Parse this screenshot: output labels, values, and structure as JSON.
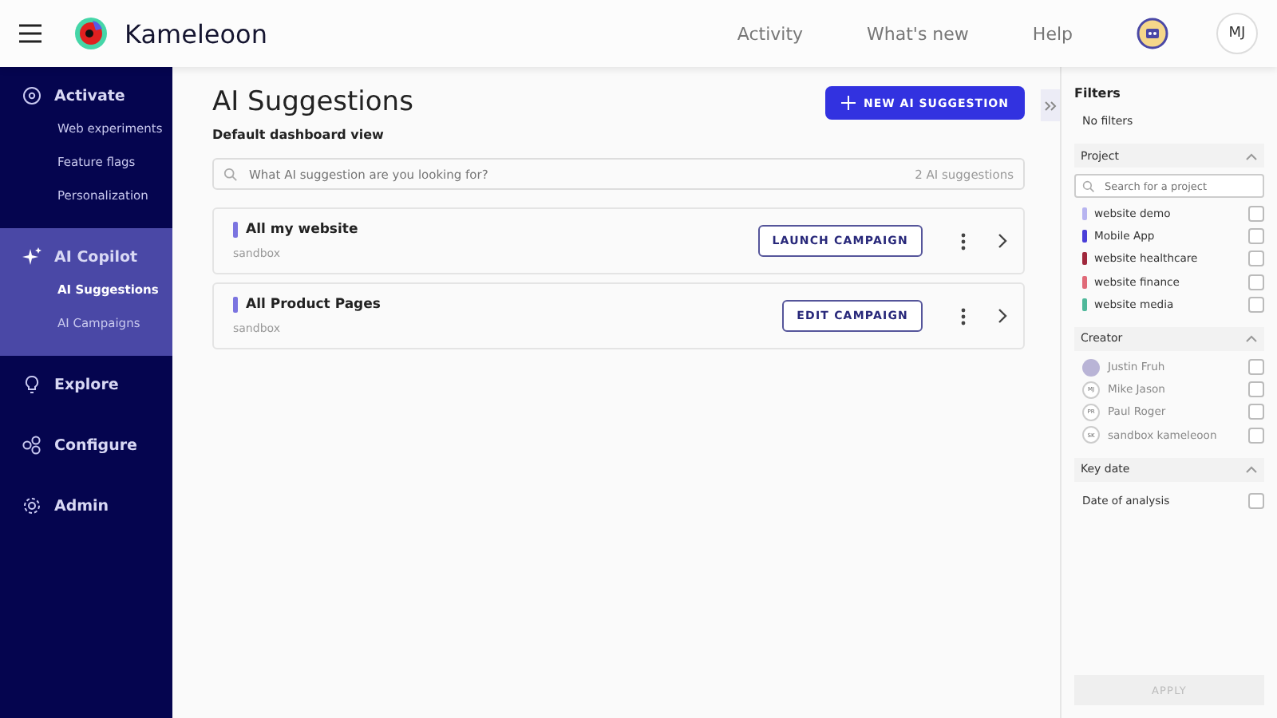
{
  "header": {
    "logo": "Kameleoon",
    "links": [
      "Activity",
      "What's new",
      "Help"
    ],
    "avatar": "MJ"
  },
  "sidebar": {
    "groups": [
      {
        "label": "Activate",
        "kind": "target",
        "selected": false,
        "items": [
          {
            "label": "Web experiments",
            "selected": false
          },
          {
            "label": "Feature flags",
            "selected": false
          },
          {
            "label": "Personalization",
            "selected": false
          }
        ]
      },
      {
        "label": "AI Copilot",
        "kind": "sparkles",
        "selected": true,
        "items": [
          {
            "label": "AI Suggestions",
            "selected": true
          },
          {
            "label": "AI Campaigns",
            "selected": false
          }
        ]
      },
      {
        "label": "Explore",
        "kind": "bulb",
        "selected": false
      },
      {
        "label": "Configure",
        "kind": "circles",
        "selected": false
      },
      {
        "label": "Admin",
        "kind": "gear",
        "selected": false
      }
    ]
  },
  "page": {
    "title": "AI Suggestions",
    "subtitle": "Default dashboard view",
    "new_button": "NEW AI SUGGESTION",
    "search": {
      "placeholder": "What AI suggestion are you looking for?"
    },
    "count": "2 AI suggestions",
    "rows": [
      {
        "name": "All my website",
        "project": "sandbox",
        "action": "LAUNCH CAMPAIGN",
        "color": "#7b74e0"
      },
      {
        "name": "All Product Pages",
        "project": "sandbox",
        "action": "EDIT CAMPAIGN",
        "color": "#7b74e0"
      }
    ]
  },
  "filters": {
    "title": "Filters",
    "summary": "No filters",
    "project": {
      "label": "Project",
      "expanded": true,
      "search": {
        "placeholder": "Search for a project"
      },
      "items": [
        {
          "label": "website demo",
          "color": "#b7b4f0",
          "checked": false
        },
        {
          "label": "Mobile App",
          "color": "#4a3fd8",
          "checked": false
        },
        {
          "label": "website healthcare",
          "color": "#a0283c",
          "checked": false
        },
        {
          "label": "website finance",
          "color": "#e06a78",
          "checked": false
        },
        {
          "label": "website media",
          "color": "#4fb89a",
          "checked": false
        }
      ]
    },
    "creator": {
      "label": "Creator",
      "expanded": true,
      "items": [
        {
          "name": "Justin Fruh",
          "kind": "photo",
          "checked": false
        },
        {
          "name": "Mike Jason",
          "initials": "MJ",
          "kind": "initials",
          "checked": false
        },
        {
          "name": "Paul Roger",
          "initials": "PR",
          "kind": "initials",
          "checked": false
        },
        {
          "name": "sandbox kameleoon",
          "initials": "SK",
          "kind": "initials",
          "checked": false
        }
      ]
    },
    "key_date": {
      "label": "Key date",
      "expanded": true,
      "items": [
        {
          "label": "Date of analysis",
          "checked": false
        }
      ]
    },
    "apply": "APPLY"
  }
}
